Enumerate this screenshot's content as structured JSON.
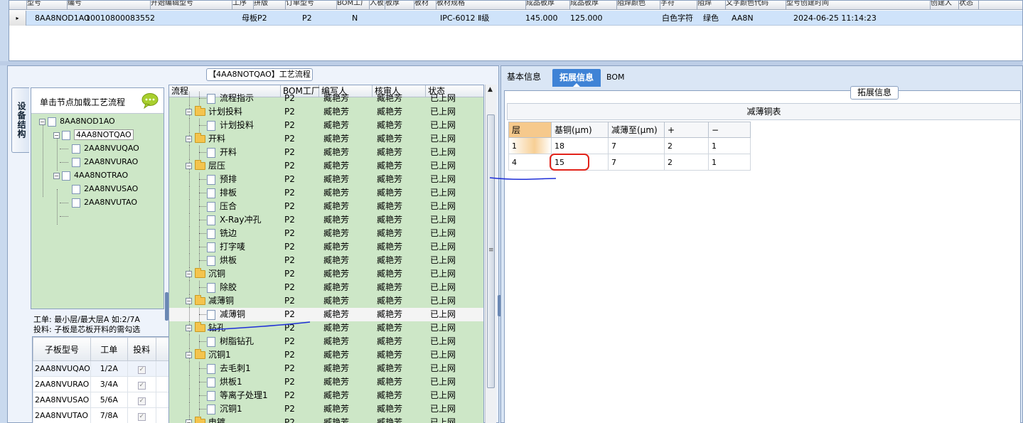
{
  "top_grid": {
    "headers": [
      "型号",
      "编号",
      "开始编辑型号",
      "工序",
      "拼版",
      "订单型号",
      "BOM工厂",
      "入板",
      "板厚",
      "板材",
      "板材规格",
      "成品板厚",
      "成品板厚",
      "阻焊颜色",
      "字符",
      "阻焊",
      "文字颜色代码",
      "型号创建时间",
      "创建人",
      "状态"
    ],
    "row": {
      "indicator": "▸",
      "model": "8AA8NOD1AO",
      "code": "10010800083552",
      "board_type": "母板",
      "factory1": "P2",
      "factory2": "P2",
      "flag": "N",
      "grade": "IPC-6012 Ⅱ级",
      "thickness1": "145.000",
      "thickness2": "125.000",
      "char_color": "白色字符",
      "mask_color": "绿色",
      "short_code": "AA8N",
      "created": "2024-06-25 11:14:23"
    }
  },
  "left": {
    "process_title": "【4AA8NOTQAO】工艺流程",
    "vertical_tab": "设备结构",
    "tree_header": "单击节点加载工艺流程",
    "tree": [
      {
        "label": "8AA8NOD1AO",
        "exp": "−"
      },
      {
        "label": "4AA8NOTQAO",
        "exp": "−"
      },
      {
        "label": "2AA8NVUQAO"
      },
      {
        "label": "2AA8NVURAO"
      },
      {
        "label": "4AA8NOTRAO",
        "exp": "−"
      },
      {
        "label": "2AA8NVUSAO"
      },
      {
        "label": "2AA8NVUTAO"
      }
    ],
    "hint_line1": "工单: 最小层/最大层A 如:2/7A",
    "hint_line2": "投料: 子板是芯板开料的需勾选",
    "sub_headers": [
      "子板型号",
      "工单",
      "投料"
    ],
    "sub_rows": [
      {
        "model": "2AA8NVUQAO",
        "order": "1/2A"
      },
      {
        "model": "2AA8NVURAO",
        "order": "3/4A"
      },
      {
        "model": "2AA8NVUSAO",
        "order": "5/6A"
      },
      {
        "model": "2AA8NVUTAO",
        "order": "7/8A"
      }
    ],
    "check_glyph": "✓",
    "proc_headers": [
      "流程",
      "BOM工厂",
      "编写人",
      "核审人",
      "状态"
    ],
    "proc_rows": [
      {
        "kind": "file",
        "label": "流程指示"
      },
      {
        "kind": "folder",
        "label": "计划投料"
      },
      {
        "kind": "file",
        "label": "计划投料"
      },
      {
        "kind": "folder",
        "label": "开料"
      },
      {
        "kind": "file",
        "label": "开料"
      },
      {
        "kind": "folder",
        "label": "层压"
      },
      {
        "kind": "file",
        "label": "预排"
      },
      {
        "kind": "file",
        "label": "排板"
      },
      {
        "kind": "file",
        "label": "压合"
      },
      {
        "kind": "file",
        "label": "X-Ray冲孔"
      },
      {
        "kind": "file",
        "label": "铣边"
      },
      {
        "kind": "file",
        "label": "打字唛"
      },
      {
        "kind": "file",
        "label": "烘板"
      },
      {
        "kind": "folder",
        "label": "沉铜"
      },
      {
        "kind": "file",
        "label": "除胶"
      },
      {
        "kind": "folder",
        "label": "减薄铜"
      },
      {
        "kind": "file",
        "label": "减薄铜",
        "selected": true
      },
      {
        "kind": "folder",
        "label": "钻孔"
      },
      {
        "kind": "file",
        "label": "树脂钻孔"
      },
      {
        "kind": "folder",
        "label": "沉铜1"
      },
      {
        "kind": "file",
        "label": "去毛刺1"
      },
      {
        "kind": "file",
        "label": "烘板1"
      },
      {
        "kind": "file",
        "label": "等离子处理1"
      },
      {
        "kind": "file",
        "label": "沉铜1"
      },
      {
        "kind": "folder",
        "label": "电镀"
      }
    ],
    "proc_factory": "P2",
    "proc_writer": "臧艳芳",
    "proc_reviewer": "臧艳芳",
    "proc_status": "已上网",
    "scroll_up": "▲",
    "scroll_grip": "≡"
  },
  "right": {
    "tabs": [
      "基本信息",
      "拓展信息",
      "BOM"
    ],
    "section_legend": "拓展信息",
    "table_title": "减薄铜表",
    "table_headers": [
      "层",
      "基铜(μm)",
      "减薄至(μm)",
      "+",
      "−"
    ],
    "table_rows": [
      [
        "1",
        "18",
        "7",
        "2",
        "1"
      ],
      [
        "4",
        "15",
        "7",
        "2",
        "1"
      ]
    ]
  },
  "colors": {
    "annotation_red": "#e2231a",
    "pen_blue": "#1f2fd8",
    "tab_active": "#3f83d6",
    "tree_bg": "#cde7c7"
  }
}
